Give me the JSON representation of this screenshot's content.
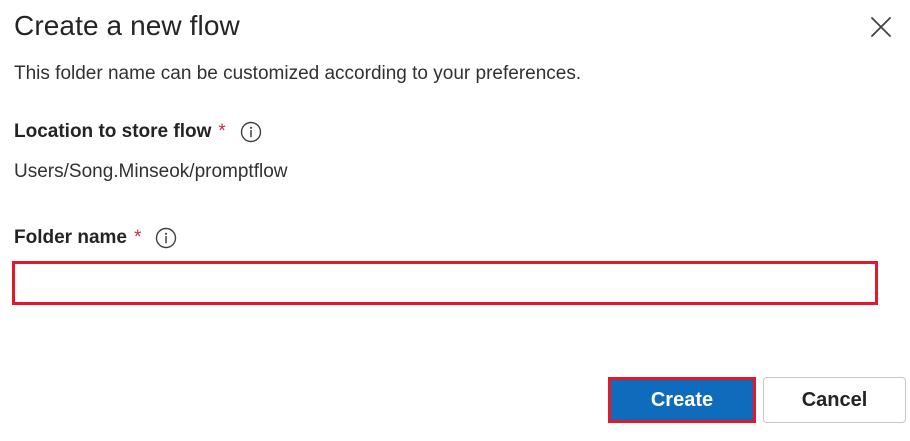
{
  "dialog": {
    "title": "Create a new flow",
    "subtitle": "This folder name can be customized according to your preferences.",
    "close_icon": "close-icon"
  },
  "location": {
    "label": "Location to store flow",
    "required_mark": "*",
    "info_icon": "info-icon",
    "value": "Users/Song.Minseok/promptflow"
  },
  "folder": {
    "label": "Folder name",
    "required_mark": "*",
    "info_icon": "info-icon",
    "value": "",
    "highlight_color": "#e3192b"
  },
  "actions": {
    "create_label": "Create",
    "cancel_label": "Cancel",
    "primary_color": "#0f6cbd"
  }
}
